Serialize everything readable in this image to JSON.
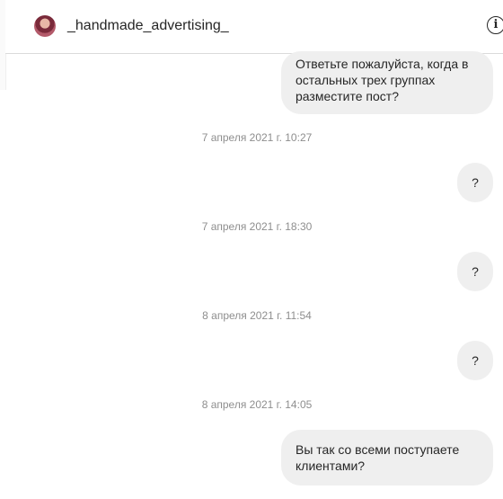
{
  "header": {
    "username": "_handmade_advertising_",
    "info_glyph": "i"
  },
  "messages": [
    {
      "type": "bubble",
      "text": "Ответьте пожалуйста, когда в остальных трех группах разместите пост?"
    },
    {
      "type": "timestamp",
      "text": "7 апреля 2021 г. 10:27"
    },
    {
      "type": "bubble",
      "text": "?"
    },
    {
      "type": "timestamp",
      "text": "7 апреля 2021 г. 18:30"
    },
    {
      "type": "bubble",
      "text": "?"
    },
    {
      "type": "timestamp",
      "text": "8 апреля 2021 г. 11:54"
    },
    {
      "type": "bubble",
      "text": "?"
    },
    {
      "type": "timestamp",
      "text": "8 апреля 2021 г. 14:05"
    },
    {
      "type": "bubble",
      "text": "Вы так со всеми поступаете клиентами?"
    }
  ],
  "colors": {
    "bubble_bg": "#efefef",
    "timestamp": "#8e8e8e",
    "text": "#262626"
  }
}
